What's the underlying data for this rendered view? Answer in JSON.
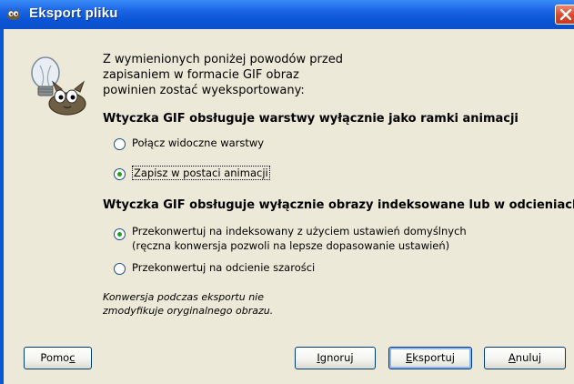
{
  "window": {
    "title": "Eksport pliku"
  },
  "message": {
    "line1": "Z wymienionych poniżej powodów przed",
    "line2": "zapisaniem w formacie GIF obraz",
    "line3": "powinien zostać wyeksportowany:"
  },
  "sections": [
    {
      "heading": "Wtyczka GIF obsługuje warstwy wyłącznie jako ramki animacji",
      "options": [
        {
          "label": "Połącz widoczne warstwy",
          "checked": false
        },
        {
          "label": "Zapisz w postaci animacji",
          "checked": true
        }
      ]
    },
    {
      "heading": "Wtyczka GIF obsługuje wyłącznie obrazy indeksowane lub w odcieniach szarości",
      "options": [
        {
          "label": "Przekonwertuj na indeksowany z użyciem ustawień domyślnych",
          "label_line2": "(ręczna konwersja pozwoli na lepsze dopasowanie ustawień)",
          "checked": true
        },
        {
          "label": "Przekonwertuj na odcienie szarości",
          "checked": false
        }
      ]
    }
  ],
  "note": {
    "line1": "Konwersja podczas eksportu nie",
    "line2": "zmodyfikuje oryginalnego obrazu."
  },
  "buttons": {
    "help": {
      "pre": "Pomo",
      "mnemonic": "c",
      "post": ""
    },
    "ignore": {
      "pre": "",
      "mnemonic": "I",
      "post": "gnoruj"
    },
    "export": {
      "pre": "",
      "mnemonic": "E",
      "post": "ksportuj"
    },
    "cancel": {
      "pre": "",
      "mnemonic": "A",
      "post": "nuluj"
    }
  },
  "colors": {
    "titlebar": "#0a55d6",
    "dialog_bg": "#ece9d8",
    "radio_check": "#21a121",
    "close_button": "#d9472b"
  },
  "icons": [
    "gimp-wilber-icon",
    "close-icon",
    "lightbulb-hint-icon"
  ]
}
